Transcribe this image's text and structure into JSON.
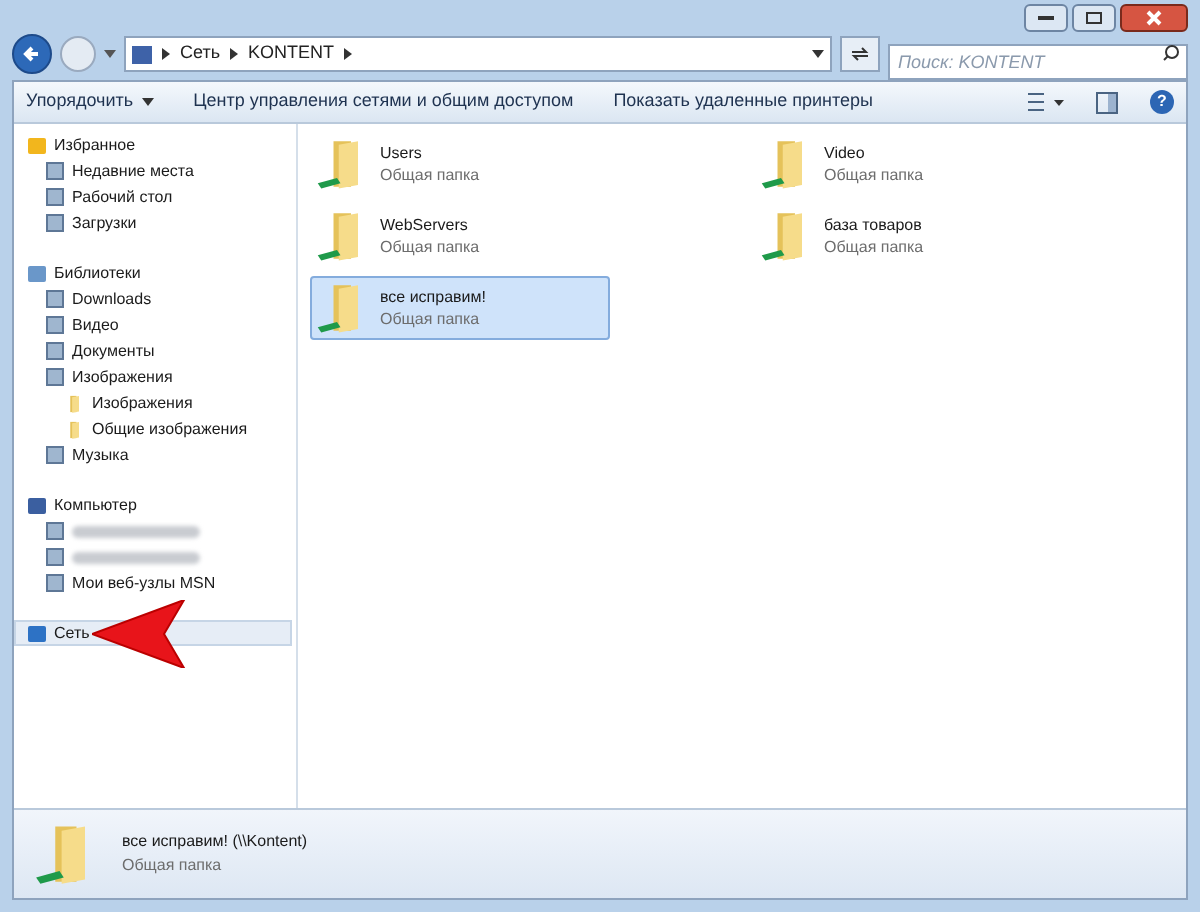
{
  "address_bar": {
    "crumbs": [
      "Сеть",
      "KONTENT"
    ]
  },
  "search": {
    "placeholder": "Поиск: KONTENT"
  },
  "toolbar": {
    "items": [
      "Упорядочить",
      "Центр управления сетями и общим доступом",
      "Показать удаленные принтеры"
    ]
  },
  "sidebar": {
    "groups": [
      {
        "label": "Избранное",
        "selected": false,
        "children": [
          {
            "label": "Недавние места",
            "selected": false
          },
          {
            "label": "Рабочий стол",
            "selected": false
          },
          {
            "label": "Загрузки",
            "selected": false
          }
        ]
      },
      {
        "label": "Библиотеки",
        "selected": false,
        "children": [
          {
            "label": "Downloads",
            "selected": false
          },
          {
            "label": "Видео",
            "selected": false
          },
          {
            "label": "Документы",
            "selected": false
          },
          {
            "label": "Изображения",
            "selected": false,
            "children": [
              {
                "label": "Изображения",
                "selected": false
              },
              {
                "label": "Общие изображения",
                "selected": false
              }
            ]
          },
          {
            "label": "Музыка",
            "selected": false
          }
        ]
      },
      {
        "label": "Компьютер",
        "selected": false,
        "children": [
          {
            "kind": "redacted",
            "selected": false
          },
          {
            "kind": "redacted",
            "selected": false
          },
          {
            "label": "Мои веб-узлы MSN",
            "selected": false
          }
        ]
      },
      {
        "label": "Сеть",
        "selected": true
      }
    ]
  },
  "help": {
    "glyph": "?"
  },
  "folders": [
    {
      "name": "Users",
      "type": "Общая папка",
      "selected": false
    },
    {
      "name": "Video",
      "type": "Общая папка",
      "selected": false
    },
    {
      "name": "WebServers",
      "type": "Общая папка",
      "selected": false
    },
    {
      "name": "база товаров",
      "type": "Общая папка",
      "selected": false
    },
    {
      "name": "все исправим!",
      "type": "Общая папка",
      "selected": true
    }
  ],
  "details": {
    "name": "все исправим! (\\\\Kontent)",
    "type": "Общая папка"
  }
}
